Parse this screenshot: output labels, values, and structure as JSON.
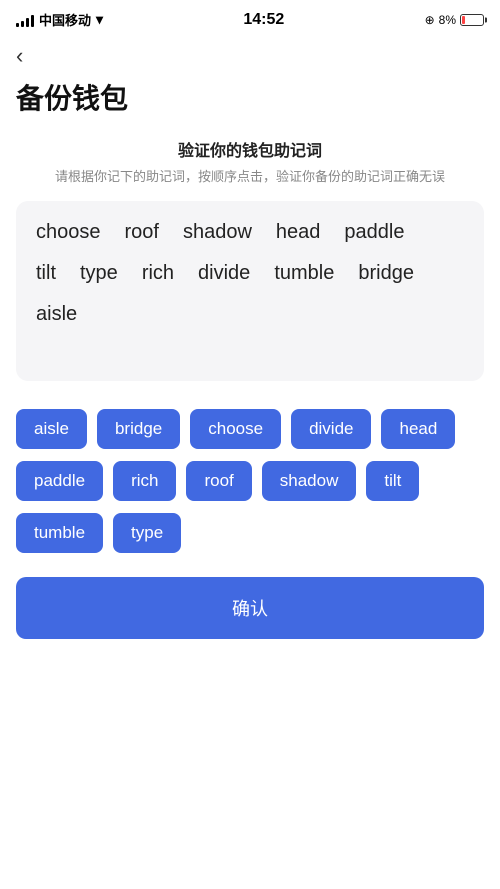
{
  "statusBar": {
    "carrier": "中国移动",
    "time": "14:52",
    "battery": "8%"
  },
  "backLabel": "‹",
  "pageTitle": "备份钱包",
  "sectionHeading": "验证你的钱包助记词",
  "sectionDesc": "请根据你记下的助记词，按顺序点击，验证你备份的助记词正确无误",
  "displayWords": [
    {
      "word": "choose"
    },
    {
      "word": "roof"
    },
    {
      "word": "shadow"
    },
    {
      "word": "head"
    },
    {
      "word": "paddle"
    },
    {
      "word": "tilt"
    },
    {
      "word": "type"
    },
    {
      "word": "rich"
    },
    {
      "word": "divide"
    },
    {
      "word": "tumble"
    },
    {
      "word": "bridge"
    },
    {
      "word": "aisle"
    }
  ],
  "chips": [
    {
      "word": "aisle"
    },
    {
      "word": "bridge"
    },
    {
      "word": "choose"
    },
    {
      "word": "divide"
    },
    {
      "word": "head"
    },
    {
      "word": "paddle"
    },
    {
      "word": "rich"
    },
    {
      "word": "roof"
    },
    {
      "word": "shadow"
    },
    {
      "word": "tilt"
    },
    {
      "word": "tumble"
    },
    {
      "word": "type"
    }
  ],
  "confirmLabel": "确认"
}
